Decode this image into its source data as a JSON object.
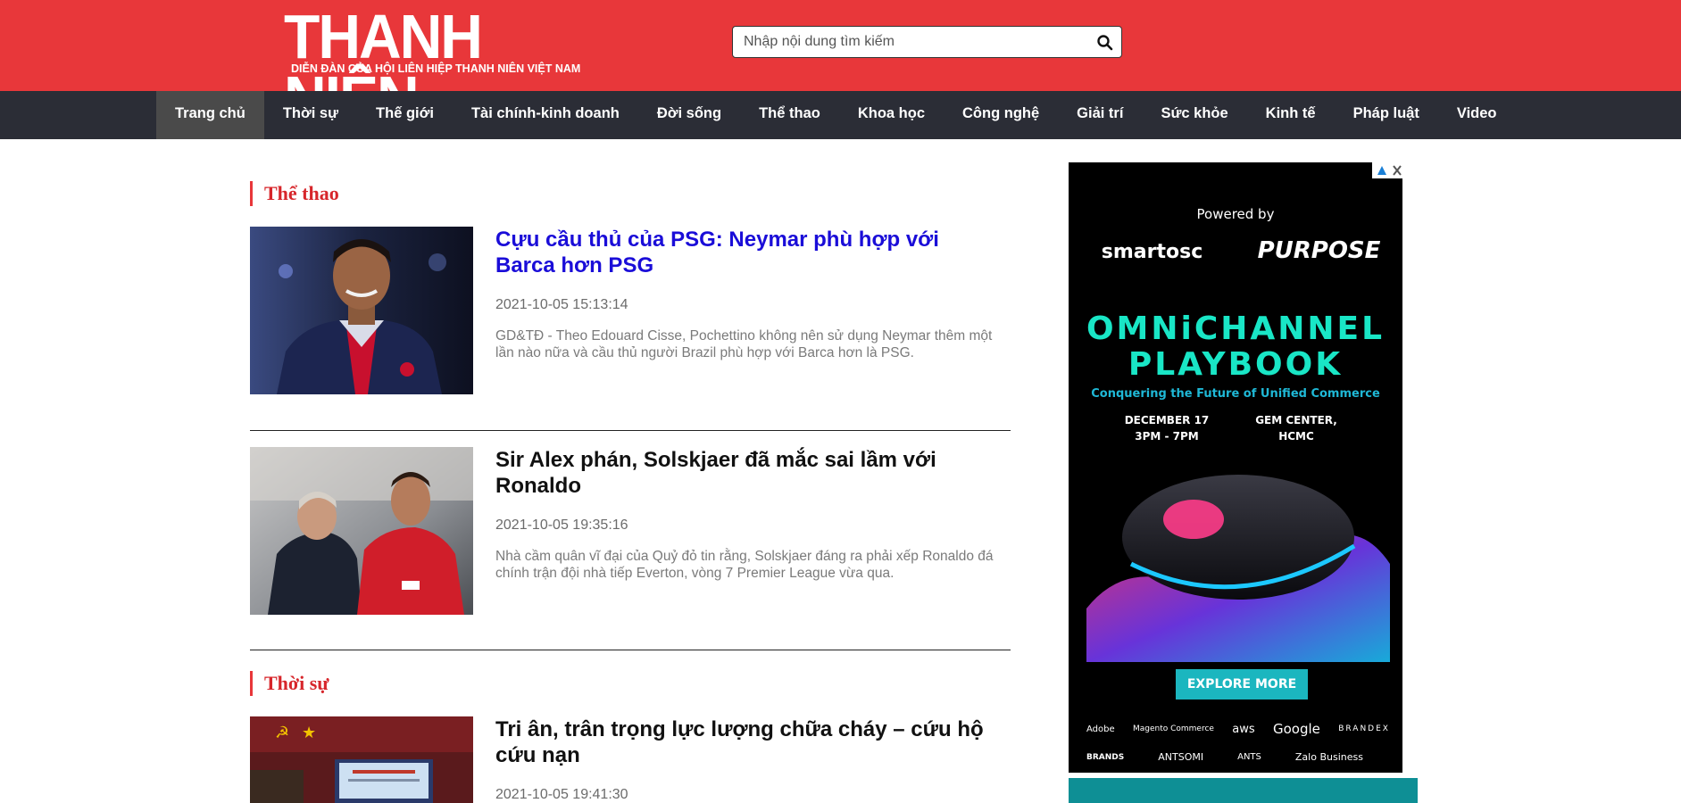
{
  "header": {
    "logo_main": "THANH NIÊN",
    "logo_sub": "DIỄN ĐÀN CỦA HỘI LIÊN HIỆP THANH NIÊN VIỆT NAM",
    "search_placeholder": "Nhập nội dung tìm kiếm",
    "search_icon": "search-icon"
  },
  "nav": {
    "items": [
      {
        "label": "Trang chủ",
        "active": true
      },
      {
        "label": "Thời sự"
      },
      {
        "label": "Thế giới"
      },
      {
        "label": "Tài chính-kinh doanh"
      },
      {
        "label": "Đời sống"
      },
      {
        "label": "Thể thao"
      },
      {
        "label": "Khoa học"
      },
      {
        "label": "Công nghệ"
      },
      {
        "label": "Giải trí"
      },
      {
        "label": "Sức khỏe"
      },
      {
        "label": "Kinh tế"
      },
      {
        "label": "Pháp luật"
      },
      {
        "label": "Video"
      }
    ]
  },
  "sections": [
    {
      "title": "Thể thao",
      "articles": [
        {
          "title": "Cựu cầu thủ của PSG: Neymar phù hợp với Barca hơn PSG",
          "date": "2021-10-05 15:13:14",
          "summary": "GD&TĐ - Theo Edouard Cisse, Pochettino không nên sử dụng Neymar thêm một lần nào nữa và cầu thủ người Brazil phù hợp với Barca hơn là PSG."
        },
        {
          "title": "Sir Alex phán, Solskjaer đã mắc sai lầm với Ronaldo",
          "date": "2021-10-05 19:35:16",
          "summary": "Nhà cầm quân vĩ đại của Quỷ đỏ tin rằng, Solskjaer đáng ra phải xếp Ronaldo đá chính trận đội nhà tiếp Everton, vòng 7 Premier League vừa qua."
        }
      ]
    },
    {
      "title": "Thời sự",
      "articles": [
        {
          "title": "Tri ân, trân trọng lực lượng chữa cháy – cứu hộ cứu nạn",
          "date": "2021-10-05 19:41:30"
        }
      ]
    }
  ],
  "ad": {
    "powered_by": "Powered by",
    "brand_left": "smartosc",
    "brand_right": "PURPOSE",
    "headline_1": "OMNiCHANNEL",
    "headline_2": "PLAYBOOK",
    "tagline": "Conquering the Future of Unified Commerce",
    "date_line_1": "DECEMBER 17",
    "date_line_2": "3PM - 7PM",
    "venue_line_1": "GEM CENTER,",
    "venue_line_2": "HCMC",
    "cta": "EXPLORE MORE",
    "partners_row_1": [
      "Adobe",
      "Magento Commerce",
      "aws",
      "Google",
      "BRANDEX"
    ],
    "partners_row_2": [
      "BRANDS",
      "ANTSOMI",
      "ANTS",
      "Zalo Business"
    ]
  },
  "colors": {
    "header_red": "#e8373a",
    "nav_dark": "#2b2d36",
    "section_red": "#d7262b",
    "link_blue": "#1a0dd8",
    "ad_teal": "#1bb6bf"
  }
}
